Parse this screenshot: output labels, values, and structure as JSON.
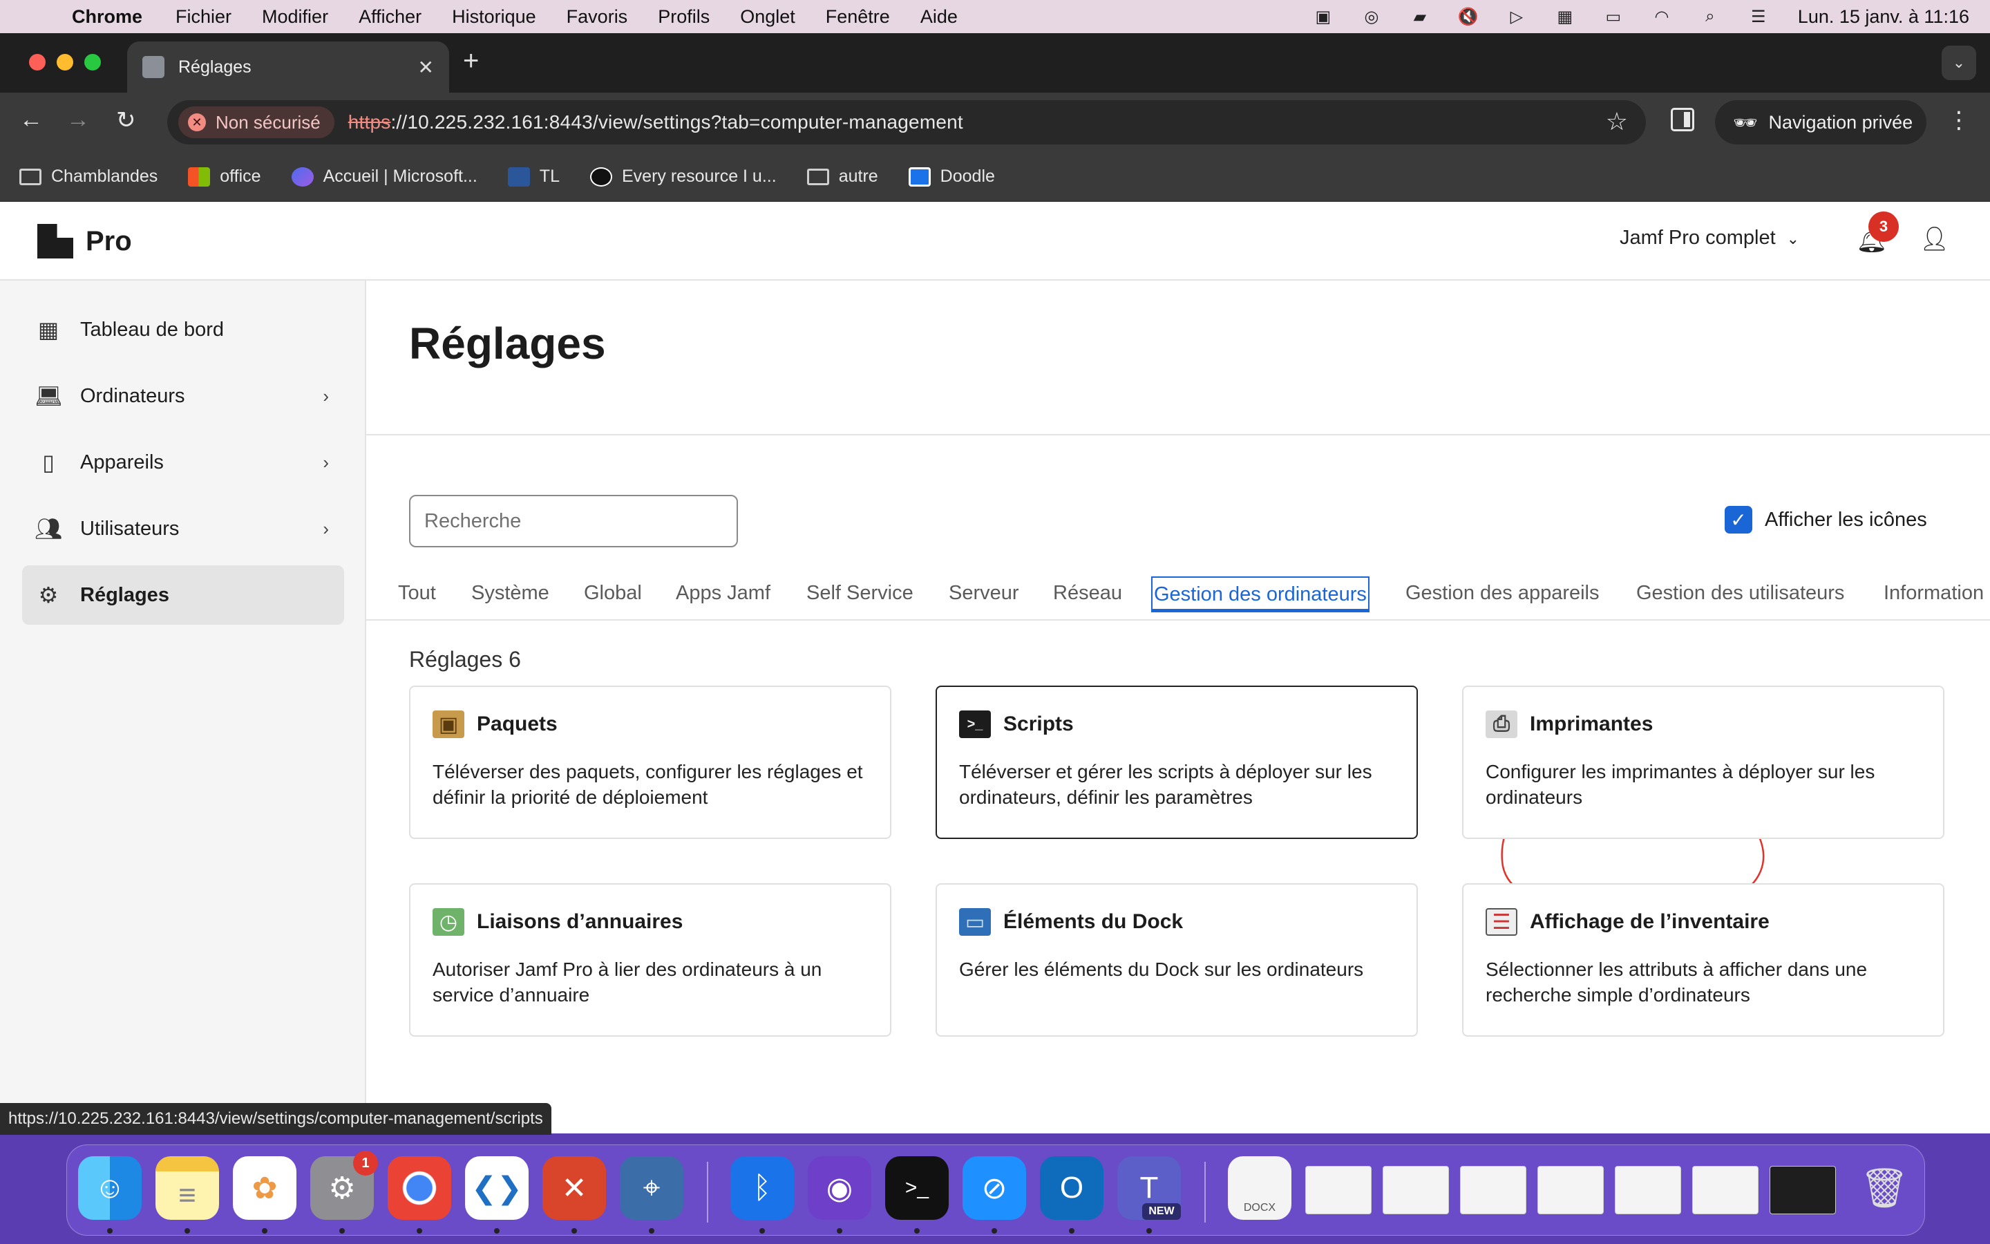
{
  "menubar": {
    "app": "Chrome",
    "items": [
      "Fichier",
      "Modifier",
      "Afficher",
      "Historique",
      "Favoris",
      "Profils",
      "Onglet",
      "Fenêtre",
      "Aide"
    ],
    "clock": "Lun. 15 janv. à  11:16"
  },
  "browser": {
    "tab_title": "Réglages",
    "security_chip": "Non sécurisé",
    "url_scheme": "https",
    "url_rest": "://10.225.232.161:8443/view/settings?tab=computer-management",
    "incognito_label": "Navigation privée",
    "bookmarks": [
      "Chamblandes",
      "office",
      "Accueil | Microsoft...",
      "TL",
      "Every resource I u...",
      "autre",
      "Doodle"
    ],
    "status_url": "https://10.225.232.161:8443/view/settings/computer-management/scripts"
  },
  "header": {
    "logo_text": "Pro",
    "environment": "Jamf Pro complet",
    "notification_count": "3"
  },
  "sidebar": {
    "items": [
      {
        "label": "Tableau de bord",
        "icon": "dashboard-icon"
      },
      {
        "label": "Ordinateurs",
        "icon": "laptop-icon"
      },
      {
        "label": "Appareils",
        "icon": "devices-icon"
      },
      {
        "label": "Utilisateurs",
        "icon": "users-icon"
      },
      {
        "label": "Réglages",
        "icon": "gear-icon"
      }
    ]
  },
  "main": {
    "title": "Réglages",
    "search_placeholder": "Recherche",
    "show_icons_label": "Afficher les icônes",
    "tabs": [
      "Tout",
      "Système",
      "Global",
      "Apps Jamf",
      "Self Service",
      "Serveur",
      "Réseau",
      "Gestion des ordinateurs",
      "Gestion des appareils",
      "Gestion des utilisateurs",
      "Information"
    ],
    "active_tab": "Gestion des ordinateurs",
    "count_label": "Réglages 6",
    "cards": [
      {
        "title": "Paquets",
        "desc": "Téléverser des paquets, configurer les réglages et définir la priorité de déploiement",
        "icon": "package-icon"
      },
      {
        "title": "Scripts",
        "desc": "Téléverser et gérer les scripts à déployer sur les ordinateurs, définir les paramètres",
        "icon": "terminal-icon"
      },
      {
        "title": "Imprimantes",
        "desc": "Configurer les imprimantes à déployer sur les ordinateurs",
        "icon": "printer-icon"
      },
      {
        "title": "Liaisons d’annuaires",
        "desc": "Autoriser Jamf Pro à lier des ordinateurs à un service d’annuaire",
        "icon": "directory-icon"
      },
      {
        "title": "Éléments du Dock",
        "desc": "Gérer les éléments du Dock sur les ordinateurs",
        "icon": "monitor-icon"
      },
      {
        "title": "Affichage de l’inventaire",
        "desc": "Sélectionner les attributs à afficher dans une recherche simple d’ordinateurs",
        "icon": "inventory-icon"
      }
    ]
  },
  "dock": {
    "settings_badge": "1",
    "teams_badge": "NEW",
    "docx_label": "DOCX"
  }
}
